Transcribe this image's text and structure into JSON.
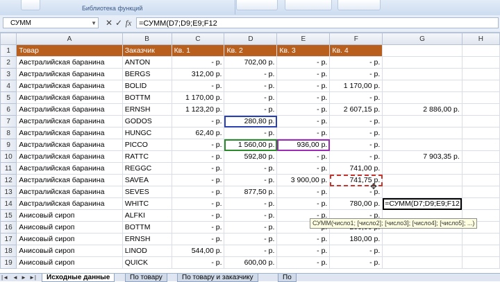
{
  "ribbon": {
    "group_label": "Библиотека функций"
  },
  "formula_bar": {
    "name_box": "СУММ",
    "cancel_icon": "✕",
    "enter_icon": "✓",
    "fx_icon": "fx",
    "formula": "=СУММ(D7;D9;E9;F12"
  },
  "columns": [
    "A",
    "B",
    "C",
    "D",
    "E",
    "F",
    "G",
    "H"
  ],
  "header_row": {
    "num": "1",
    "a": "Товар",
    "b": "Заказчик",
    "c": "Кв. 1",
    "d": "Кв. 2",
    "e": "Кв. 3",
    "f": "Кв. 4",
    "g": "",
    "h": ""
  },
  "rows": [
    {
      "num": "2",
      "a": "Австралийская баранина",
      "b": "ANTON",
      "c": "-    р.",
      "d": "702,00 р.",
      "e": "-    р.",
      "f": "-    р.",
      "g": "",
      "h": ""
    },
    {
      "num": "3",
      "a": "Австралийская баранина",
      "b": "BERGS",
      "c": "312,00 р.",
      "d": "-    р.",
      "e": "-    р.",
      "f": "-    р.",
      "g": "",
      "h": ""
    },
    {
      "num": "4",
      "a": "Австралийская баранина",
      "b": "BOLID",
      "c": "-    р.",
      "d": "-    р.",
      "e": "-    р.",
      "f": "1 170,00 р.",
      "g": "",
      "h": ""
    },
    {
      "num": "5",
      "a": "Австралийская баранина",
      "b": "BOTTM",
      "c": "1 170,00 р.",
      "d": "-    р.",
      "e": "-    р.",
      "f": "-    р.",
      "g": "",
      "h": ""
    },
    {
      "num": "6",
      "a": "Австралийская баранина",
      "b": "ERNSH",
      "c": "1 123,20 р.",
      "d": "-    р.",
      "e": "-    р.",
      "f": "2 607,15 р.",
      "g": "2 886,00 р.",
      "h": ""
    },
    {
      "num": "7",
      "a": "Австралийская баранина",
      "b": "GODOS",
      "c": "-    р.",
      "d": "280,80 р.",
      "e": "-    р.",
      "f": "-    р.",
      "g": "",
      "h": ""
    },
    {
      "num": "8",
      "a": "Австралийская баранина",
      "b": "HUNGC",
      "c": "62,40 р.",
      "d": "-    р.",
      "e": "-    р.",
      "f": "-    р.",
      "g": "",
      "h": ""
    },
    {
      "num": "9",
      "a": "Австралийская баранина",
      "b": "PICCO",
      "c": "-    р.",
      "d": "1 560,00 р.",
      "e": "936,00 р.",
      "f": "-    р.",
      "g": "",
      "h": ""
    },
    {
      "num": "10",
      "a": "Австралийская баранина",
      "b": "RATTC",
      "c": "-    р.",
      "d": "592,80 р.",
      "e": "-    р.",
      "f": "-    р.",
      "g": "7 903,35 р.",
      "h": ""
    },
    {
      "num": "11",
      "a": "Австралийская баранина",
      "b": "REGGC",
      "c": "-    р.",
      "d": "-    р.",
      "e": "-    р.",
      "f": "741,00 р.",
      "g": "",
      "h": ""
    },
    {
      "num": "12",
      "a": "Австралийская баранина",
      "b": "SAVEA",
      "c": "-    р.",
      "d": "-    р.",
      "e": "3 900,00 р.",
      "f": "741,75 р.",
      "g": "",
      "h": ""
    },
    {
      "num": "13",
      "a": "Австралийская баранина",
      "b": "SEVES",
      "c": "-    р.",
      "d": "877,50 р.",
      "e": "-    р.",
      "f": "-    р.",
      "g": "",
      "h": ""
    },
    {
      "num": "14",
      "a": "Австралийская баранина",
      "b": "WHITC",
      "c": "-    р.",
      "d": "-    р.",
      "e": "-    р.",
      "f": "780,00 р.",
      "g": "=СУММ(D7;D9;E9;F12",
      "h": ""
    },
    {
      "num": "15",
      "a": "Анисовый сироп",
      "b": "ALFKI",
      "c": "-    р.",
      "d": "-    р.",
      "e": "-    р.",
      "f": "-    р.",
      "g": "",
      "h": ""
    },
    {
      "num": "16",
      "a": "Анисовый сироп",
      "b": "BOTTM",
      "c": "-    р.",
      "d": "-    р.",
      "e": "-    р.",
      "f": "200,00 р.",
      "g": "",
      "h": ""
    },
    {
      "num": "17",
      "a": "Анисовый сироп",
      "b": "ERNSH",
      "c": "-    р.",
      "d": "-    р.",
      "e": "-    р.",
      "f": "180,00 р.",
      "g": "",
      "h": ""
    },
    {
      "num": "18",
      "a": "Анисовый сироп",
      "b": "LINOD",
      "c": "544,00 р.",
      "d": "-    р.",
      "e": "-    р.",
      "f": "-    р.",
      "g": "",
      "h": ""
    },
    {
      "num": "19",
      "a": "Анисовый сироп",
      "b": "QUICK",
      "c": "-    р.",
      "d": "600,00 р.",
      "e": "-    р.",
      "f": "-    р.",
      "g": "",
      "h": ""
    }
  ],
  "tooltip": "СУММ(число1; [число2]; [число3]; [число4]; [число5]; ...)",
  "sheet_tabs": [
    "Исходные данные",
    "По товару",
    "По товару и заказчику",
    "По"
  ],
  "nav_icons": [
    "|◄",
    "◄",
    "►",
    "►|"
  ]
}
